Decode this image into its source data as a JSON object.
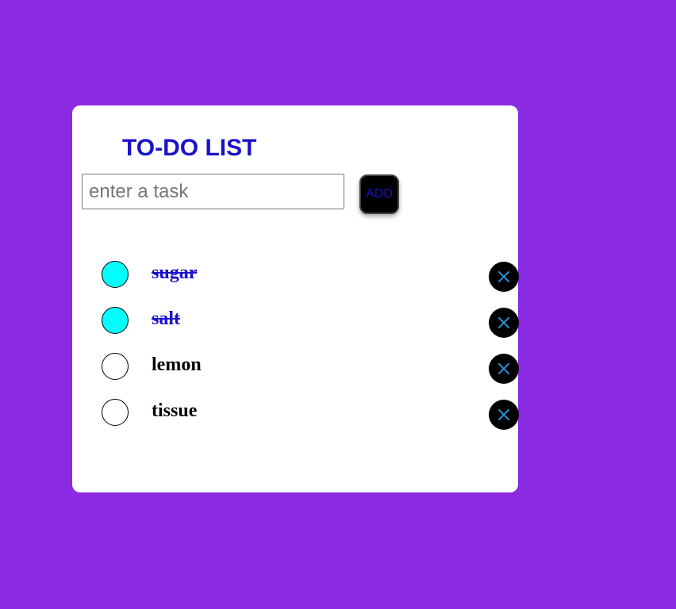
{
  "app": {
    "title": "TO-DO LIST"
  },
  "input": {
    "placeholder": "enter a task",
    "value": ""
  },
  "add_button": {
    "label": "ADD"
  },
  "tasks": [
    {
      "label": "sugar",
      "done": true
    },
    {
      "label": "salt",
      "done": true
    },
    {
      "label": "lemon",
      "done": false
    },
    {
      "label": "tissue",
      "done": false
    }
  ],
  "icons": {
    "delete": "close-icon",
    "checkbox": "circle-check-icon"
  },
  "colors": {
    "background": "#8a2be2",
    "card": "#ffffff",
    "accent": "#1a12c9",
    "done_fill": "#00ffff",
    "delete_x": "#2f8fd8"
  }
}
